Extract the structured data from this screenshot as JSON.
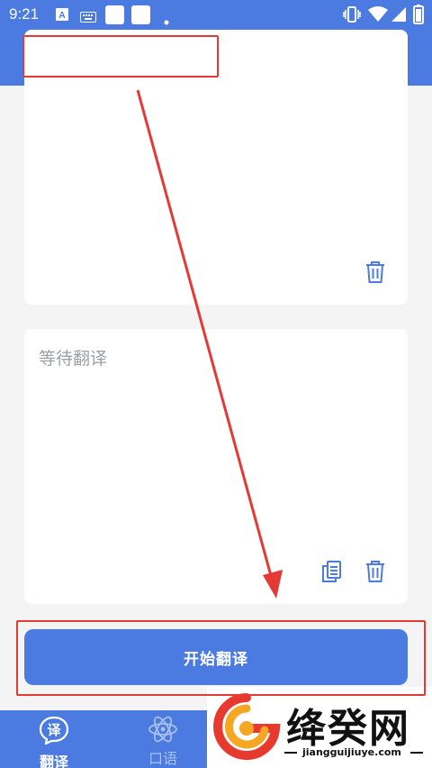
{
  "status_bar": {
    "time": "9:21",
    "icons": [
      "a-badge-icon",
      "keyboard-icon",
      "square-icon",
      "square-icon",
      "dot-icon",
      "vibrate-icon",
      "wifi-icon",
      "signal-icon",
      "battery-icon"
    ]
  },
  "input_card": {
    "text": "",
    "icons": [
      "trash-icon"
    ]
  },
  "output_card": {
    "placeholder": "等待翻译",
    "icons": [
      "copy-icon",
      "trash-icon"
    ]
  },
  "translate_button": {
    "label": "开始翻译"
  },
  "bottom_nav": {
    "items": [
      {
        "label": "翻译",
        "icon": "translate-bubble-icon",
        "active": true
      },
      {
        "label": "口语",
        "icon": "atom-icon",
        "active": false
      }
    ]
  },
  "watermark": {
    "title": "绛癸网",
    "url": "jiangguijiuye.com"
  },
  "colors": {
    "primary": "#4b7be0",
    "background": "#f4f4f4",
    "annotation": "#e53935"
  }
}
